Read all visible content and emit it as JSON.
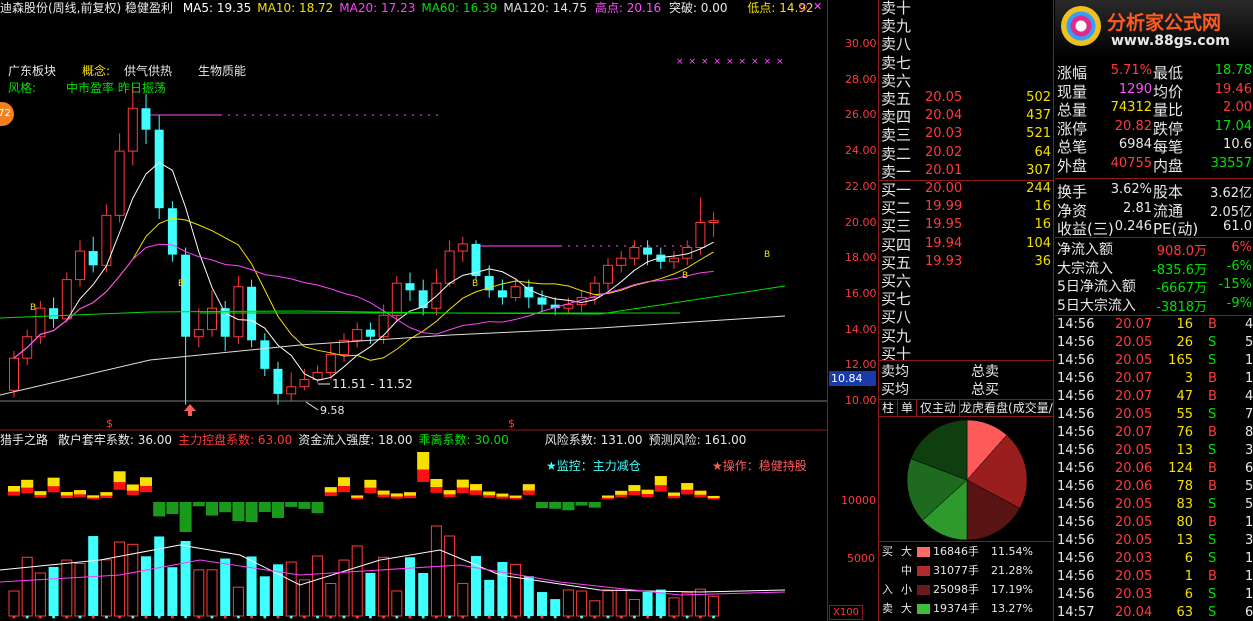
{
  "header": {
    "stock_title": "迪森股份(周线,前复权) 稳健盈利",
    "ma": [
      {
        "label": "MA5: 19.35",
        "color": "#ffffff"
      },
      {
        "label": "MA10: 18.72",
        "color": "#f5e000"
      },
      {
        "label": "MA20: 17.23",
        "color": "#ff40ff"
      },
      {
        "label": "MA60: 16.39",
        "color": "#00e000"
      },
      {
        "label": "MA120: 14.75",
        "color": "#e0e0e0"
      }
    ],
    "high_label": "高点: 20.16",
    "break_label": "突破: 0.00",
    "low_label": "低点: 14.92"
  },
  "info": {
    "sector_label": "广东板块",
    "concept_label": "概念:",
    "concept_values": "供气供热",
    "concept_extra": "生物质能",
    "style_label": "风格:",
    "style_values": "中市盈率 昨日振荡",
    "badge": "72"
  },
  "main_chart": {
    "annot_range": "11.51 - 11.52",
    "annot_low": "9.58",
    "signal_marks": [
      "$",
      "$"
    ],
    "price_axis": [
      "30.00",
      "28.00",
      "26.00",
      "24.00",
      "22.00",
      "20.00",
      "18.00",
      "16.00",
      "14.00",
      "12.00",
      "10.00"
    ],
    "current_price": "10.84",
    "candles": [
      [
        10.6,
        12.4,
        10.2,
        12.8
      ],
      [
        12.4,
        13.6,
        12.0,
        14.0
      ],
      [
        13.6,
        15.2,
        13.2,
        15.6
      ],
      [
        15.2,
        14.6,
        14.1,
        15.8
      ],
      [
        14.6,
        16.8,
        14.4,
        17.2
      ],
      [
        16.8,
        18.4,
        16.4,
        19.0
      ],
      [
        18.4,
        17.6,
        17.2,
        19.2
      ],
      [
        17.6,
        20.4,
        17.2,
        21.0
      ],
      [
        20.4,
        24.0,
        20.0,
        25.0
      ],
      [
        24.0,
        26.4,
        23.2,
        27.6
      ],
      [
        26.4,
        25.2,
        24.4,
        27.2
      ],
      [
        25.2,
        20.8,
        20.2,
        26.0
      ],
      [
        20.8,
        18.2,
        17.8,
        21.2
      ],
      [
        18.2,
        13.6,
        9.8,
        18.6
      ],
      [
        13.6,
        14.0,
        13.0,
        15.2
      ],
      [
        14.0,
        15.2,
        13.6,
        16.2
      ],
      [
        15.2,
        13.6,
        12.8,
        15.6
      ],
      [
        13.6,
        16.4,
        13.2,
        17.0
      ],
      [
        16.4,
        13.4,
        13.0,
        16.8
      ],
      [
        13.4,
        11.8,
        11.4,
        13.8
      ],
      [
        11.8,
        10.4,
        9.8,
        12.2
      ],
      [
        10.4,
        10.8,
        10.0,
        11.6
      ],
      [
        10.8,
        11.2,
        10.6,
        11.8
      ],
      [
        11.2,
        11.6,
        11.0,
        12.0
      ],
      [
        11.6,
        12.6,
        11.2,
        13.2
      ],
      [
        12.6,
        13.4,
        12.2,
        13.8
      ],
      [
        13.4,
        14.0,
        13.0,
        14.4
      ],
      [
        14.0,
        13.6,
        13.2,
        14.4
      ],
      [
        13.6,
        14.8,
        13.2,
        15.4
      ],
      [
        14.8,
        16.6,
        14.4,
        17.0
      ],
      [
        16.6,
        16.2,
        15.6,
        17.2
      ],
      [
        16.2,
        15.2,
        14.8,
        16.8
      ],
      [
        15.2,
        16.6,
        14.8,
        17.4
      ],
      [
        16.6,
        18.4,
        16.4,
        19.0
      ],
      [
        18.4,
        18.8,
        17.8,
        19.2
      ],
      [
        18.8,
        17.0,
        16.8,
        19.0
      ],
      [
        17.0,
        16.2,
        15.8,
        17.6
      ],
      [
        16.2,
        15.8,
        15.4,
        16.8
      ],
      [
        15.8,
        16.4,
        15.6,
        16.8
      ],
      [
        16.4,
        15.8,
        15.2,
        16.8
      ],
      [
        15.8,
        15.4,
        15.0,
        16.2
      ],
      [
        15.4,
        15.2,
        14.8,
        15.8
      ],
      [
        15.2,
        15.4,
        14.9,
        15.8
      ],
      [
        15.4,
        15.8,
        15.0,
        16.2
      ],
      [
        15.8,
        16.6,
        15.4,
        17.0
      ],
      [
        16.6,
        17.6,
        16.2,
        18.0
      ],
      [
        17.6,
        18.0,
        17.2,
        18.4
      ],
      [
        18.0,
        18.6,
        17.6,
        19.0
      ],
      [
        18.6,
        18.2,
        17.6,
        19.0
      ],
      [
        18.2,
        17.8,
        17.4,
        18.6
      ],
      [
        17.8,
        18.0,
        17.4,
        18.4
      ],
      [
        18.0,
        18.6,
        17.6,
        19.0
      ],
      [
        18.6,
        20.0,
        18.2,
        21.4
      ],
      [
        20.0,
        20.1,
        19.2,
        20.6
      ]
    ]
  },
  "indicator": {
    "title": "猎手之路",
    "items": [
      {
        "text": "散户套牢系数: 36.00",
        "color": "#e8e8e8"
      },
      {
        "text": "主力控盘系数: 63.00",
        "color": "#ff3b3b"
      },
      {
        "text": "资金流入强度: 18.00",
        "color": "#e8e8e8"
      },
      {
        "text": "乖离系数: 30.00",
        "color": "#00e000"
      },
      {
        "text": "风险系数: 131.00",
        "color": "#e8e8e8"
      },
      {
        "text": "预测风险: 161.00",
        "color": "#e8e8e8"
      }
    ],
    "monitor": "★监控：主力减仓",
    "operation": "★操作：稳健持股",
    "axis": [
      "10000",
      "5000"
    ],
    "unit": "X100"
  },
  "order_book": {
    "sell_empty": [
      "卖十",
      "卖九",
      "卖八",
      "卖七",
      "卖六"
    ],
    "sells": [
      {
        "label": "卖五",
        "price": "20.05",
        "vol": "502"
      },
      {
        "label": "卖四",
        "price": "20.04",
        "vol": "437"
      },
      {
        "label": "卖三",
        "price": "20.03",
        "vol": "521"
      },
      {
        "label": "卖二",
        "price": "20.02",
        "vol": "64"
      },
      {
        "label": "卖一",
        "price": "20.01",
        "vol": "307"
      }
    ],
    "buys": [
      {
        "label": "买一",
        "price": "20.00",
        "vol": "244"
      },
      {
        "label": "买二",
        "price": "19.99",
        "vol": "16"
      },
      {
        "label": "买三",
        "price": "19.95",
        "vol": "16"
      },
      {
        "label": "买四",
        "price": "19.94",
        "vol": "104"
      },
      {
        "label": "买五",
        "price": "19.93",
        "vol": "36"
      }
    ],
    "buy_empty": [
      "买六",
      "买七",
      "买八",
      "买九",
      "买十"
    ],
    "avg_sell": "卖均",
    "avg_buy": "买均",
    "total_sell": "总卖",
    "total_buy": "总买"
  },
  "tabs": [
    "柱",
    "单",
    "仅主动",
    "龙虎看盘(成交量/笔"
  ],
  "pie": {
    "slices": [
      {
        "pct": 11.54,
        "color": "#ff5a5a"
      },
      {
        "pct": 21.28,
        "color": "#9a1e1e"
      },
      {
        "pct": 17.19,
        "color": "#5a1414"
      },
      {
        "pct": 13.27,
        "color": "#2e9a2e"
      },
      {
        "pct": 17.5,
        "color": "#1e6a1e"
      },
      {
        "pct": 19.22,
        "color": "#0f3f0f"
      }
    ]
  },
  "flow_legend": [
    {
      "side": "买",
      "size": "大",
      "color": "#ff6a6a",
      "vol": "16846手",
      "pct": "11.54%"
    },
    {
      "side": "",
      "size": "中",
      "color": "#b02a2a",
      "vol": "31077手",
      "pct": "21.28%"
    },
    {
      "side": "入",
      "size": "小",
      "color": "#6a1a1a",
      "vol": "25098手",
      "pct": "17.19%"
    },
    {
      "side": "卖",
      "size": "大",
      "color": "#3cc03c",
      "vol": "19374手",
      "pct": "13.27%"
    }
  ],
  "quote": {
    "logo_main": "分析家公式网",
    "logo_url": "www.88gs.com",
    "rows": [
      {
        "l1": "涨幅",
        "v1": "5.71%",
        "c1": "#ff3b3b",
        "l2": "最低",
        "v2": "18.78",
        "c2": "#00e000"
      },
      {
        "l1": "现量",
        "v1": "1290",
        "c1": "#ff50ff",
        "l2": "均价",
        "v2": "19.46",
        "c2": "#ff3b3b"
      },
      {
        "l1": "总量",
        "v1": "74312",
        "c1": "#f5e000",
        "l2": "量比",
        "v2": "2.00",
        "c2": "#ff3b3b"
      },
      {
        "l1": "涨停",
        "v1": "20.82",
        "c1": "#ff3b3b",
        "l2": "跌停",
        "v2": "17.04",
        "c2": "#00e000"
      },
      {
        "l1": "总笔",
        "v1": "6984",
        "c1": "#e8e8e8",
        "l2": "每笔",
        "v2": "10.6",
        "c2": "#e8e8e8"
      },
      {
        "l1": "外盘",
        "v1": "40755",
        "c1": "#ff3b3b",
        "l2": "内盘",
        "v2": "33557",
        "c2": "#00e000"
      }
    ],
    "rows2": [
      {
        "l1": "换手",
        "v1": "3.62%",
        "l2": "股本",
        "v2": "3.62亿"
      },
      {
        "l1": "净资",
        "v1": "2.81",
        "l2": "流通",
        "v2": "2.05亿"
      },
      {
        "l1": "收益(三)",
        "v1": "0.246",
        "l2": "PE(动)",
        "v2": "61.0"
      }
    ],
    "flows": [
      {
        "label": "净流入额",
        "value": "908.0万",
        "pct": "6%",
        "color": "#ff3b3b"
      },
      {
        "label": "大宗流入",
        "value": "-835.6万",
        "pct": "-6%",
        "color": "#00e000"
      },
      {
        "label": "5日净流入额",
        "value": "-6667万",
        "pct": "-15%",
        "color": "#00e000"
      },
      {
        "label": "5日大宗流入",
        "value": "-3818万",
        "pct": "-9%",
        "color": "#00e000"
      }
    ]
  },
  "ticks": [
    {
      "t": "14:56",
      "p": "20.07",
      "v": "16",
      "s": "B",
      "n": "4"
    },
    {
      "t": "14:56",
      "p": "20.05",
      "v": "26",
      "s": "S",
      "n": "5"
    },
    {
      "t": "14:56",
      "p": "20.05",
      "v": "165",
      "s": "S",
      "n": "10"
    },
    {
      "t": "14:56",
      "p": "20.07",
      "v": "3",
      "s": "B",
      "n": "1"
    },
    {
      "t": "14:56",
      "p": "20.07",
      "v": "47",
      "s": "B",
      "n": "4"
    },
    {
      "t": "14:56",
      "p": "20.05",
      "v": "55",
      "s": "S",
      "n": "7"
    },
    {
      "t": "14:56",
      "p": "20.07",
      "v": "76",
      "s": "B",
      "n": "8"
    },
    {
      "t": "14:56",
      "p": "20.05",
      "v": "13",
      "s": "S",
      "n": "3"
    },
    {
      "t": "14:56",
      "p": "20.06",
      "v": "124",
      "s": "B",
      "n": "6"
    },
    {
      "t": "14:56",
      "p": "20.06",
      "v": "78",
      "s": "B",
      "n": "5"
    },
    {
      "t": "14:56",
      "p": "20.05",
      "v": "83",
      "s": "S",
      "n": "5"
    },
    {
      "t": "14:56",
      "p": "20.05",
      "v": "80",
      "s": "B",
      "n": "10"
    },
    {
      "t": "14:56",
      "p": "20.05",
      "v": "13",
      "s": "S",
      "n": "3"
    },
    {
      "t": "14:56",
      "p": "20.03",
      "v": "6",
      "s": "S",
      "n": "1"
    },
    {
      "t": "14:56",
      "p": "20.05",
      "v": "1",
      "s": "B",
      "n": "1"
    },
    {
      "t": "14:56",
      "p": "20.03",
      "v": "6",
      "s": "S",
      "n": "1"
    },
    {
      "t": "14:57",
      "p": "20.04",
      "v": "63",
      "s": "S",
      "n": "6"
    }
  ]
}
